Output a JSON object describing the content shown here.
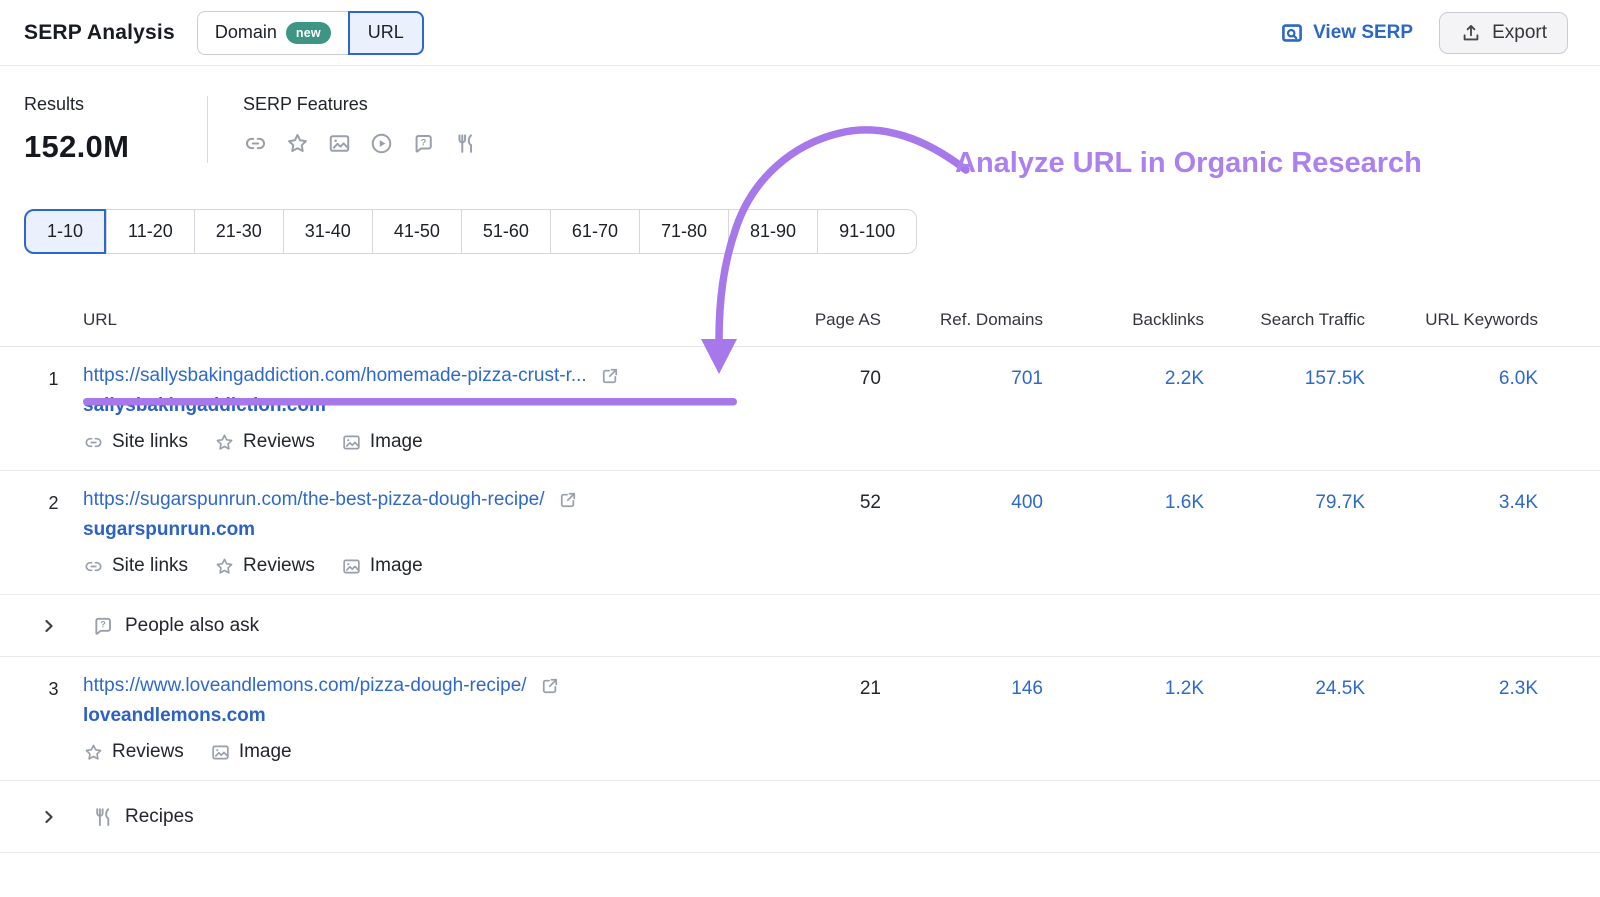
{
  "header": {
    "title": "SERP Analysis",
    "toggle": {
      "domain_label": "Domain",
      "new_badge": "new",
      "url_label": "URL",
      "selected": "URL"
    },
    "view_serp_label": "View SERP",
    "export_label": "Export"
  },
  "summary": {
    "results_label": "Results",
    "results_value": "152.0M",
    "serp_features_label": "SERP Features",
    "feature_icons": [
      "sitelinks-icon",
      "reviews-star-icon",
      "image-icon",
      "video-icon",
      "people-also-ask-icon",
      "recipes-icon"
    ]
  },
  "pagination": {
    "selected": "1-10",
    "ranges": [
      "1-10",
      "11-20",
      "21-30",
      "31-40",
      "41-50",
      "51-60",
      "61-70",
      "71-80",
      "81-90",
      "91-100"
    ]
  },
  "annotation": {
    "text": "Analyze URL in Organic Research",
    "color": "#ad80f0",
    "underline_color": "#a678ea"
  },
  "table": {
    "columns": [
      "URL",
      "Page AS",
      "Ref. Domains",
      "Backlinks",
      "Search Traffic",
      "URL Keywords"
    ],
    "rows": [
      {
        "rank": "1",
        "url": "https://sallysbakingaddiction.com/homemade-pizza-crust-r...",
        "domain": "sallysbakingaddiction.com",
        "features": [
          {
            "icon": "sitelinks-icon",
            "label": "Site links"
          },
          {
            "icon": "reviews-star-icon",
            "label": "Reviews"
          },
          {
            "icon": "image-icon",
            "label": "Image"
          }
        ],
        "page_as": "70",
        "ref_domains": "701",
        "backlinks": "2.2K",
        "search_traffic": "157.5K",
        "url_keywords": "6.0K"
      },
      {
        "rank": "2",
        "url": "https://sugarspunrun.com/the-best-pizza-dough-recipe/",
        "domain": "sugarspunrun.com",
        "features": [
          {
            "icon": "sitelinks-icon",
            "label": "Site links"
          },
          {
            "icon": "reviews-star-icon",
            "label": "Reviews"
          },
          {
            "icon": "image-icon",
            "label": "Image"
          }
        ],
        "page_as": "52",
        "ref_domains": "400",
        "backlinks": "1.6K",
        "search_traffic": "79.7K",
        "url_keywords": "3.4K"
      },
      {
        "rank": "3",
        "url": "https://www.loveandlemons.com/pizza-dough-recipe/",
        "domain": "loveandlemons.com",
        "features": [
          {
            "icon": "reviews-star-icon",
            "label": "Reviews"
          },
          {
            "icon": "image-icon",
            "label": "Image"
          }
        ],
        "page_as": "21",
        "ref_domains": "146",
        "backlinks": "1.2K",
        "search_traffic": "24.5K",
        "url_keywords": "2.3K"
      }
    ],
    "feature_rows": [
      {
        "icon": "people-also-ask-icon",
        "label": "People also ask"
      },
      {
        "icon": "recipes-icon",
        "label": "Recipes"
      }
    ]
  },
  "colors": {
    "link_blue": "#2f68cd",
    "accent_blue": "#2e65d2",
    "badge_green": "#3d9583",
    "annotation_purple": "#ad80f0"
  }
}
